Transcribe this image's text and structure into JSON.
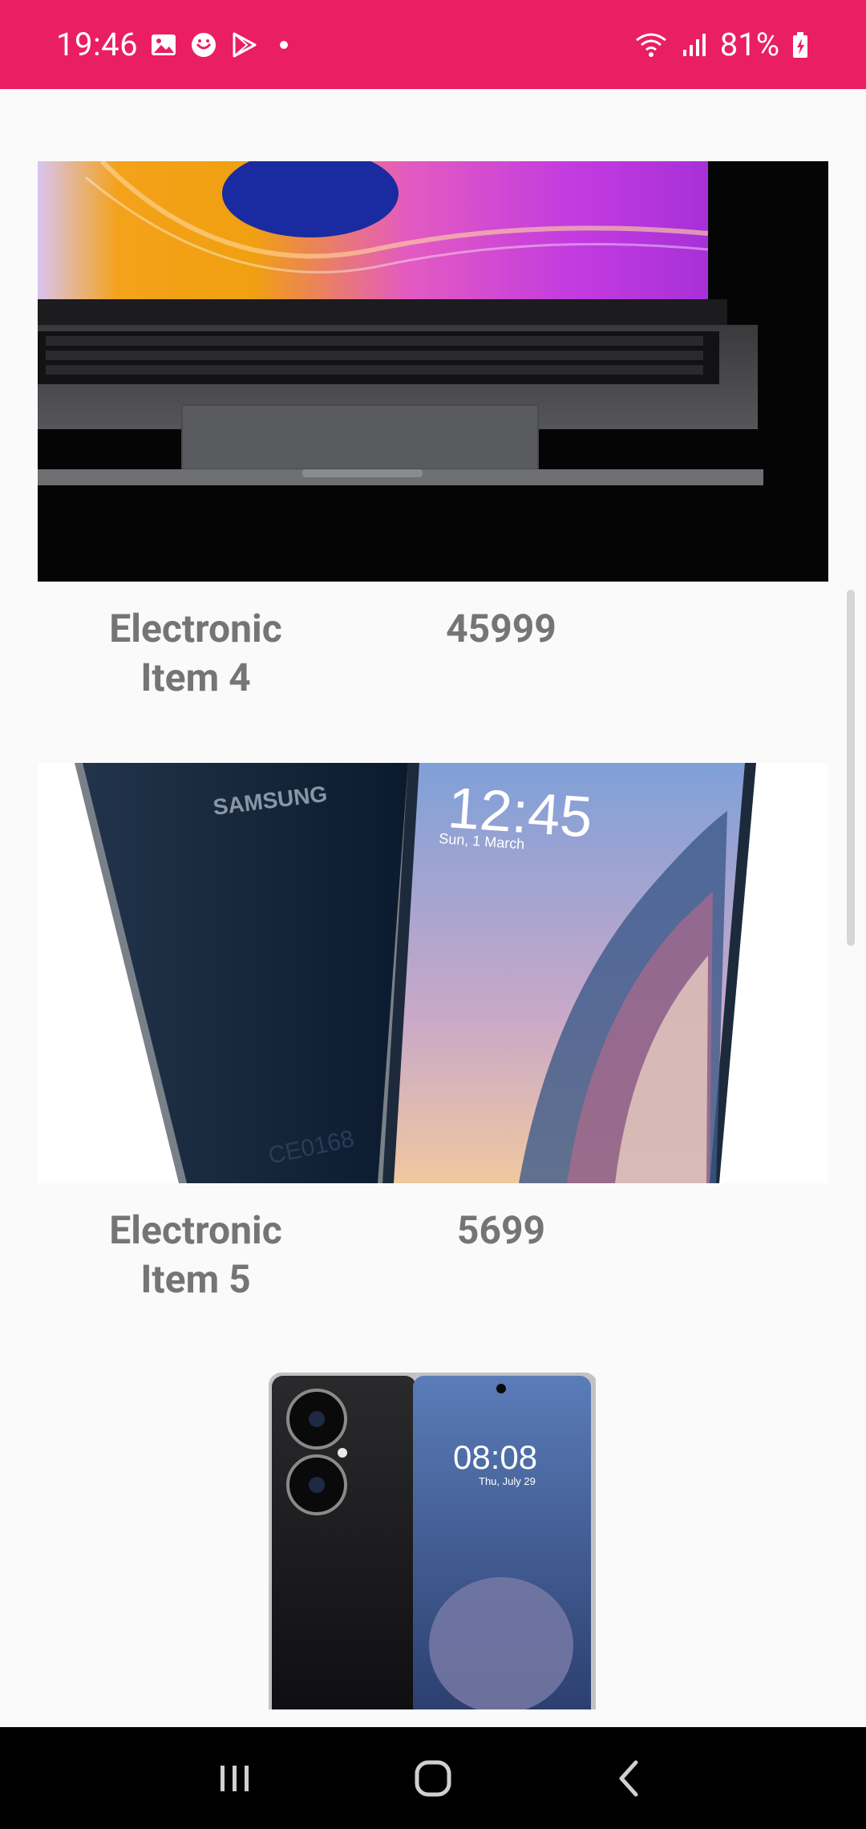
{
  "status_bar": {
    "time": "19:46",
    "battery_percent": "81%",
    "icons": [
      "gallery-icon",
      "messenger-icon",
      "play-store-icon",
      "dot-icon",
      "wifi-icon",
      "signal-icon",
      "battery-charging-icon"
    ],
    "background_color": "#e91e63"
  },
  "items": [
    {
      "name": "Electronic Item 4",
      "price": "45999",
      "image": "laptop-image"
    },
    {
      "name": "Electronic Item 5",
      "price": "5699",
      "image": "samsung-phone-image"
    },
    {
      "image": "huawei-phone-image"
    }
  ],
  "nav_bar": {
    "buttons": [
      "recents-icon",
      "home-icon",
      "back-icon"
    ]
  },
  "colors": {
    "text_gray": "#757575",
    "background": "#fafafa"
  }
}
